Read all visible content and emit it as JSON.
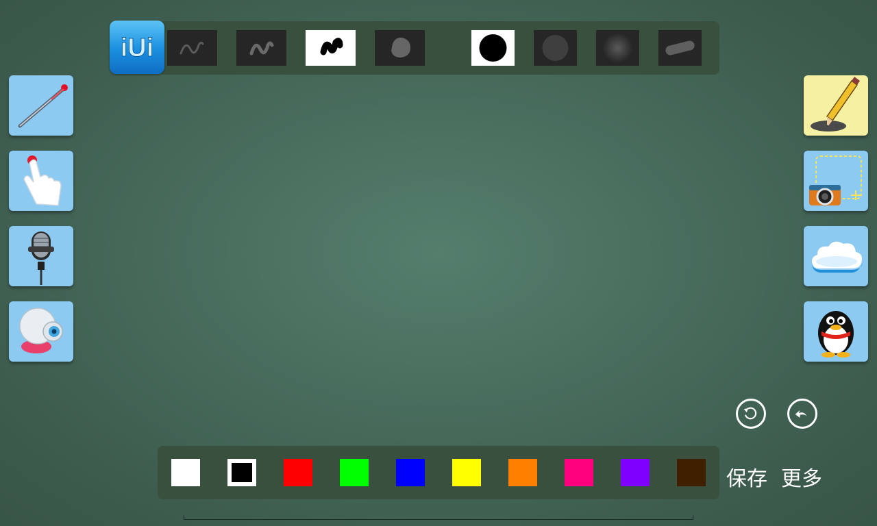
{
  "app": {
    "logo_text": "iUi"
  },
  "brushes": [
    {
      "icon": "thin-wave-brush-icon",
      "selected": false
    },
    {
      "icon": "thick-wave-brush-icon",
      "selected": false
    },
    {
      "icon": "ink-blob-brush-icon",
      "selected": true
    },
    {
      "icon": "soft-round-brush-icon",
      "selected": false
    },
    {
      "icon": "large-dot-brush-icon",
      "selected": true
    },
    {
      "icon": "medium-dot-brush-icon",
      "selected": false
    },
    {
      "icon": "airbrush-icon",
      "selected": false
    },
    {
      "icon": "marker-brush-icon",
      "selected": false
    }
  ],
  "left_tools": [
    {
      "icon": "laser-pointer-icon"
    },
    {
      "icon": "hand-touch-icon"
    },
    {
      "icon": "microphone-icon"
    },
    {
      "icon": "webcam-icon"
    }
  ],
  "right_tools": [
    {
      "icon": "pencil-icon"
    },
    {
      "icon": "camera-capture-icon"
    },
    {
      "icon": "cloud-icon"
    },
    {
      "icon": "qq-penguin-icon"
    }
  ],
  "history": {
    "redo_icon": "rotate-icon",
    "undo_icon": "undo-arrow-icon"
  },
  "colors": [
    {
      "hex": "#ffffff",
      "selected": false
    },
    {
      "hex": "#000000",
      "selected": true
    },
    {
      "hex": "#ff0000",
      "selected": false
    },
    {
      "hex": "#00ff00",
      "selected": false
    },
    {
      "hex": "#0000ff",
      "selected": false
    },
    {
      "hex": "#ffff00",
      "selected": false
    },
    {
      "hex": "#ff7f00",
      "selected": false
    },
    {
      "hex": "#ff007f",
      "selected": false
    },
    {
      "hex": "#7f00ff",
      "selected": false
    },
    {
      "hex": "#3f1f00",
      "selected": false
    }
  ],
  "actions": {
    "save_label": "保存",
    "more_label": "更多"
  }
}
